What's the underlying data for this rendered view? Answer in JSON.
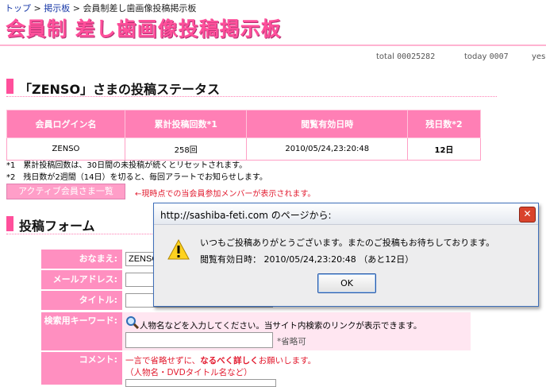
{
  "breadcrumb": {
    "top": "トップ",
    "sep1": ">",
    "board": "掲示板",
    "sep2": ">",
    "current": "会員制差し歯画像投稿掲示板"
  },
  "site_title": "会員制 差し歯画像投稿掲示板",
  "counter": {
    "total_label": "total",
    "total_value": "00025282",
    "today_label": "today",
    "today_value": "0007",
    "yesterday_label": "yes"
  },
  "status_section": {
    "heading": "「ZENSO」さまの投稿ステータス",
    "headers": [
      "会員ログイン名",
      "累計投稿回数*1",
      "閲覧有効日時",
      "残日数*2"
    ],
    "row": [
      "ZENSO",
      "258回",
      "2010/05/24,23:20:48",
      "12日"
    ],
    "notes": [
      "*1　累計投稿回数は、30日間の未投稿が続くとリセットされます。",
      "*2　残日数が2週間（14日）を切ると、毎回アラートでお知らせします。"
    ],
    "active_button": "アクティブ会員さま一覧",
    "active_note": "←現時点での当会員参加メンバーが表示されます。"
  },
  "form_section": {
    "heading": "投稿フォーム",
    "name_label": "おなまえ:",
    "name_value": "ZENSO",
    "mail_label": "メールアドレス:",
    "title_label": "タイトル:",
    "keyword_label": "検索用キーワード:",
    "keyword_help": "人物名などを入力してください。当サイト内検索のリンクが表示できます。",
    "keyword_optional": "*省略可",
    "comment_label": "コメント:",
    "comment_help_pre": "一言で省略せずに、",
    "comment_help_em": "なるべく詳しく",
    "comment_help_post": "お願いします。",
    "comment_help_line2": "（人物名・DVDタイトル名など）"
  },
  "dialog": {
    "title": "http://sashiba-feti.com のページから:",
    "message_line1": "いつもご投稿ありがとうございます。またのご投稿もお待ちしております。",
    "message_line2": "閲覧有効日時： 2010/05/24,23:20:48 （あと12日）",
    "ok_label": "OK",
    "close_symbol": "✕",
    "icon": "warning-icon"
  },
  "colors": {
    "brand_pink": "#ff4f9b",
    "header_pink": "#ff7fb5",
    "alert_red": "#e21a2e"
  }
}
